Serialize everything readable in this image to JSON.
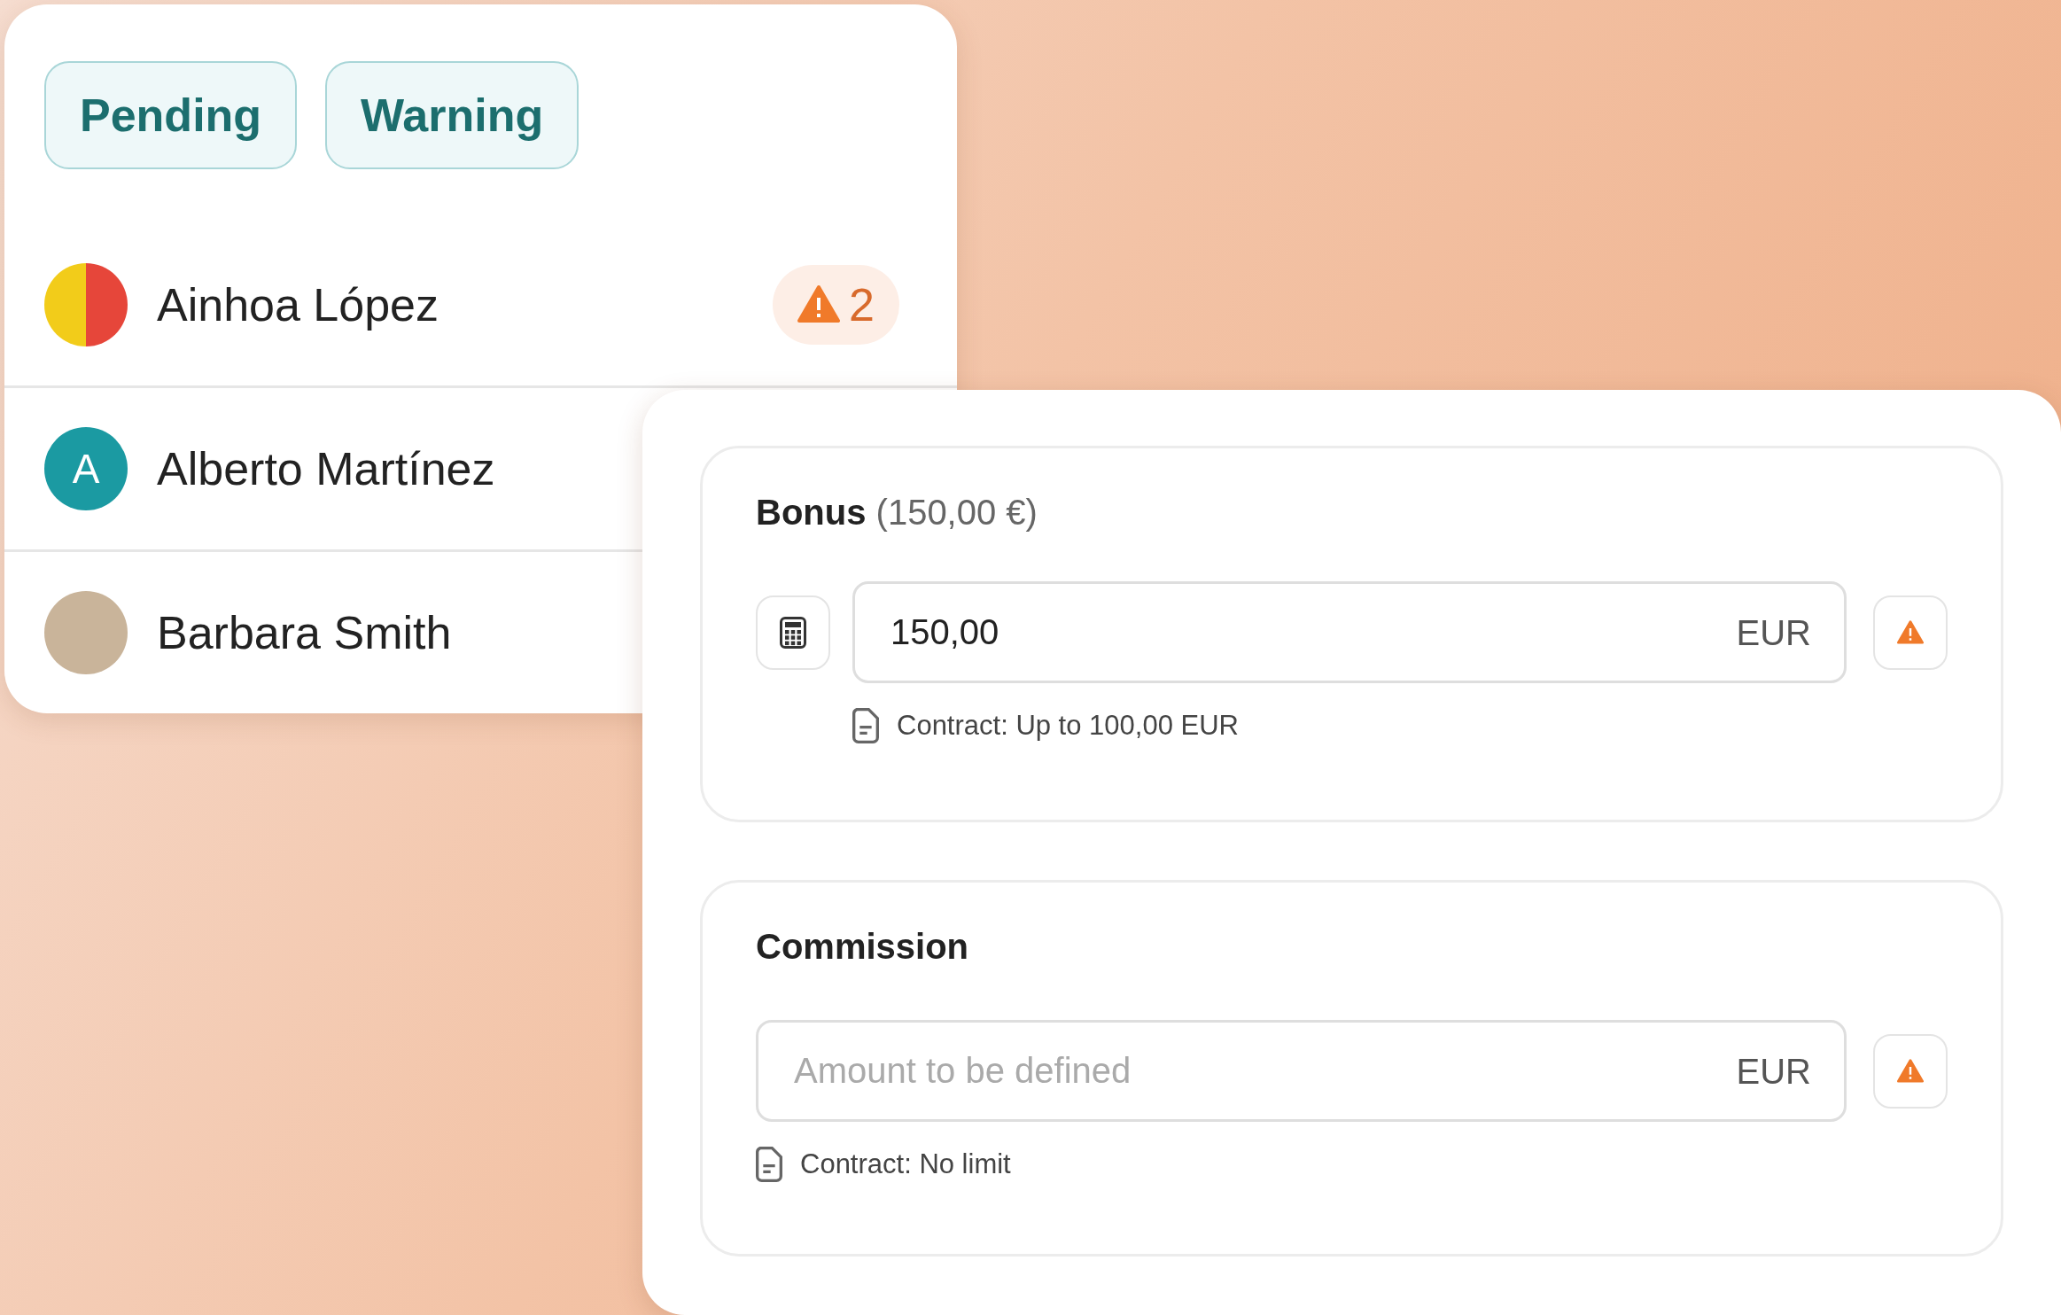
{
  "tags": [
    {
      "label": "Pending"
    },
    {
      "label": "Warning"
    }
  ],
  "people": [
    {
      "name": "Ainhoa López",
      "avatar": {
        "kind": "photo"
      },
      "warning_count": "2"
    },
    {
      "name": "Alberto Martínez",
      "avatar": {
        "kind": "initial",
        "letter": "A"
      }
    },
    {
      "name": "Barbara Smith",
      "avatar": {
        "kind": "photo"
      }
    }
  ],
  "sections": [
    {
      "title": "Bonus",
      "title_note": "(150,00 €)",
      "calculator": true,
      "value": "150,00",
      "currency": "EUR",
      "note": "Contract: Up to 100,00 EUR"
    },
    {
      "title": "Commission",
      "calculator": false,
      "placeholder": "Amount to be defined",
      "currency": "EUR",
      "note": "Contract: No limit"
    }
  ]
}
